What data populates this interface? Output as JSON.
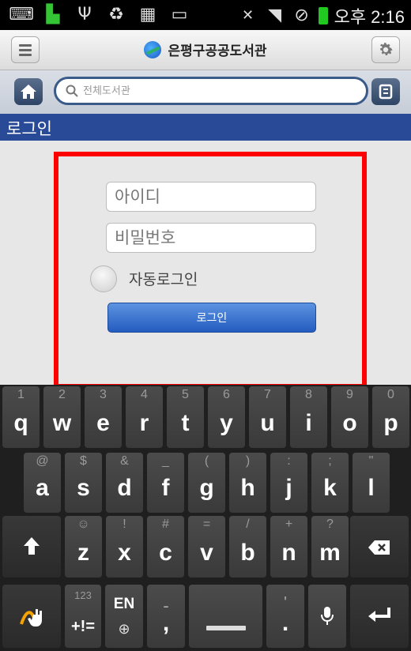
{
  "statusbar": {
    "icons": [
      "keyboard-icon",
      "android-icon",
      "usb-icon",
      "recycle-icon",
      "sim-icon",
      "image-icon",
      "mute-icon",
      "wifi-icon",
      "block-icon",
      "battery-icon"
    ],
    "time": "오후 2:16"
  },
  "header": {
    "title": "은평구공공도서관"
  },
  "search": {
    "placeholder": "전체도서관"
  },
  "section": {
    "title": "로그인"
  },
  "login": {
    "id_placeholder": "아이디",
    "pw_placeholder": "비밀번호",
    "auto_login_label": "자동로그인",
    "button_label": "로그인"
  },
  "keyboard": {
    "row1": [
      {
        "main": "q",
        "sub": "1"
      },
      {
        "main": "w",
        "sub": "2"
      },
      {
        "main": "e",
        "sub": "3"
      },
      {
        "main": "r",
        "sub": "4"
      },
      {
        "main": "t",
        "sub": "5"
      },
      {
        "main": "y",
        "sub": "6"
      },
      {
        "main": "u",
        "sub": "7"
      },
      {
        "main": "i",
        "sub": "8"
      },
      {
        "main": "o",
        "sub": "9"
      },
      {
        "main": "p",
        "sub": "0"
      }
    ],
    "row2": [
      {
        "main": "a",
        "sub": "@"
      },
      {
        "main": "s",
        "sub": "$"
      },
      {
        "main": "d",
        "sub": "&"
      },
      {
        "main": "f",
        "sub": "_"
      },
      {
        "main": "g",
        "sub": "("
      },
      {
        "main": "h",
        "sub": ")"
      },
      {
        "main": "j",
        "sub": ":"
      },
      {
        "main": "k",
        "sub": ";"
      },
      {
        "main": "l",
        "sub": "\""
      }
    ],
    "row3": [
      {
        "main": "z",
        "sub": "☺"
      },
      {
        "main": "x",
        "sub": "!"
      },
      {
        "main": "c",
        "sub": "#"
      },
      {
        "main": "v",
        "sub": "="
      },
      {
        "main": "b",
        "sub": "/"
      },
      {
        "main": "n",
        "sub": "+"
      },
      {
        "main": "m",
        "sub": "?"
      }
    ],
    "sym_label": "123",
    "sym_main": "+!=",
    "lang_label": "EN",
    "comma_main": ",",
    "comma_sub": "-",
    "period_main": ".",
    "period_sub": "'"
  }
}
